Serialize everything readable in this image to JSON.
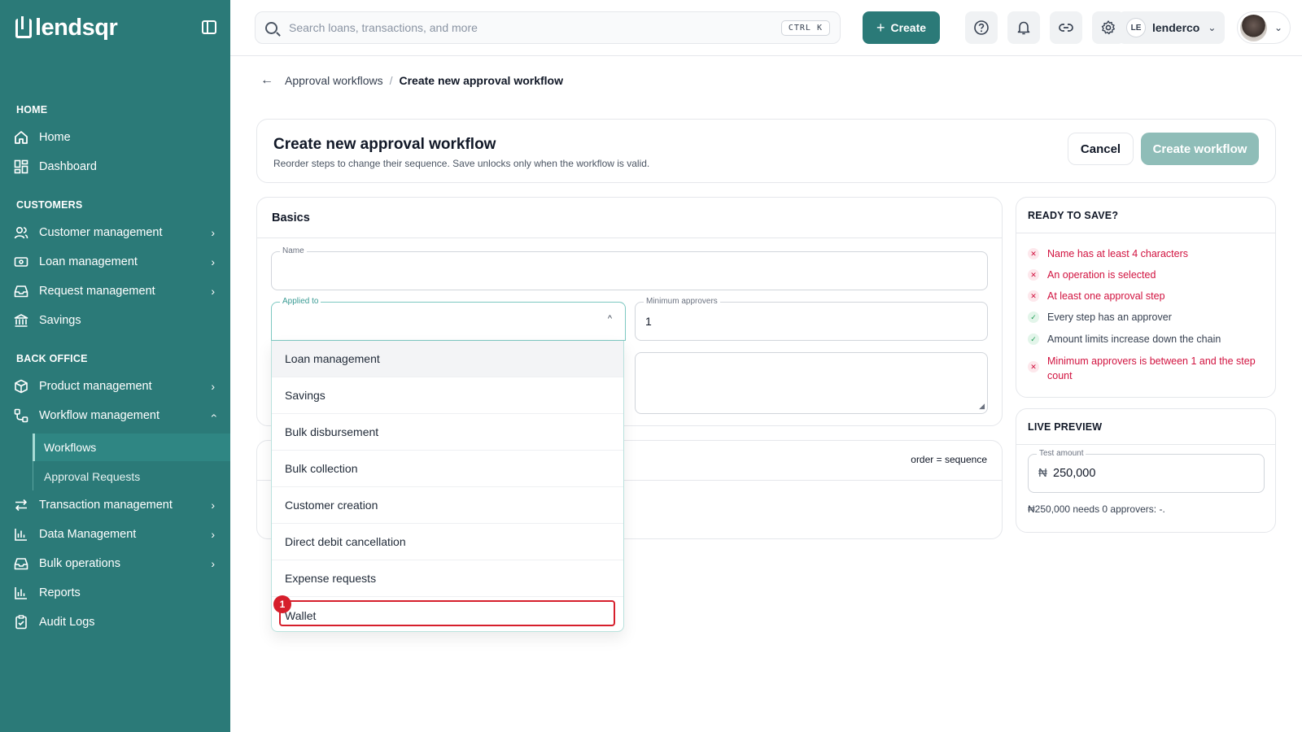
{
  "sidebar": {
    "logo": "lendsqr",
    "sections": {
      "home": "HOME",
      "customers": "CUSTOMERS",
      "back_office": "BACK OFFICE"
    },
    "items": {
      "home": "Home",
      "dashboard": "Dashboard",
      "customer_management": "Customer management",
      "loan_management": "Loan management",
      "request_management": "Request management",
      "savings": "Savings",
      "product_management": "Product management",
      "workflow_management": "Workflow management",
      "workflows": "Workflows",
      "approval_requests": "Approval Requests",
      "transaction_management": "Transaction management",
      "data_management": "Data Management",
      "bulk_operations": "Bulk operations",
      "reports": "Reports",
      "audit_logs": "Audit Logs"
    }
  },
  "topbar": {
    "search_placeholder": "Search loans, transactions, and more",
    "shortcut": "CTRL K",
    "create_label": "Create",
    "account_initials": "LE",
    "account_name": "lenderco"
  },
  "breadcrumb": {
    "parent": "Approval workflows",
    "separator": "/",
    "current": "Create new approval workflow"
  },
  "header": {
    "title": "Create new approval workflow",
    "subtitle": "Reorder steps to change their sequence. Save unlocks only when the workflow is valid.",
    "cancel_label": "Cancel",
    "create_label": "Create workflow"
  },
  "basics": {
    "title": "Basics",
    "name_label": "Name",
    "name_value": "",
    "applied_to_label": "Applied to",
    "applied_to_value": "",
    "min_approvers_label": "Minimum approvers",
    "min_approvers_value": "1"
  },
  "steps": {
    "hint": "order = sequence"
  },
  "dropdown": {
    "options": [
      "Loan management",
      "Savings",
      "Bulk disbursement",
      "Bulk collection",
      "Customer creation",
      "Direct debit cancellation",
      "Expense requests",
      "Wallet"
    ],
    "marker": "1"
  },
  "ready": {
    "title": "READY TO SAVE?",
    "checks": [
      {
        "text": "Name has at least 4 characters",
        "status": "fail"
      },
      {
        "text": "An operation is selected",
        "status": "fail"
      },
      {
        "text": "At least one approval step",
        "status": "fail"
      },
      {
        "text": "Every step has an approver",
        "status": "pass"
      },
      {
        "text": "Amount limits increase down the chain",
        "status": "pass"
      },
      {
        "text": "Minimum approvers is between 1 and the step count",
        "status": "fail"
      }
    ]
  },
  "preview": {
    "title": "LIVE PREVIEW",
    "amount_label": "Test amount",
    "currency_symbol": "₦",
    "amount_value": "250,000",
    "note": "₦250,000 needs 0 approvers: -."
  },
  "colors": {
    "sidebar": "#2b7a78",
    "accent": "#2b7a78",
    "disabled_primary": "#8fbdb8",
    "error": "#d1123f",
    "success": "#1f9d55"
  }
}
